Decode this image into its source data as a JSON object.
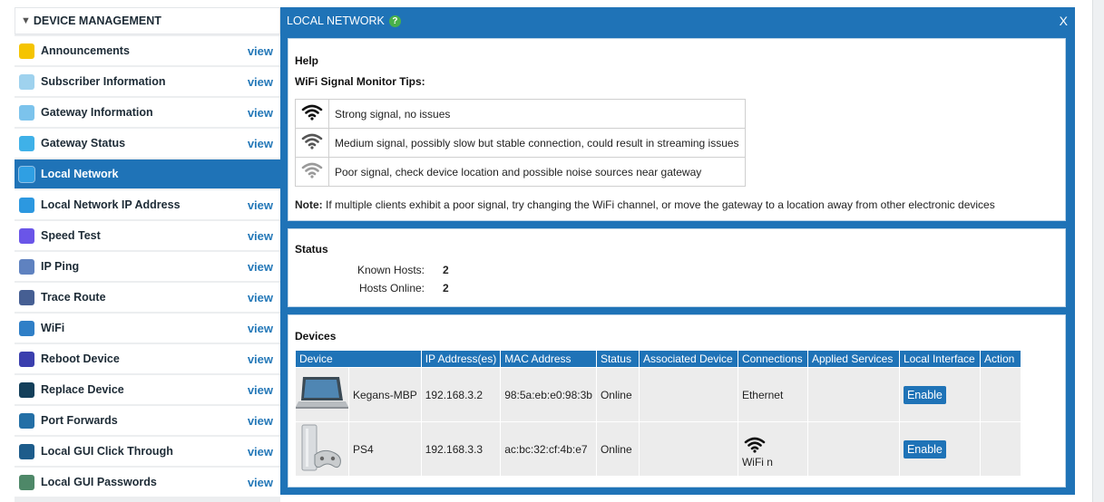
{
  "sidebar": {
    "header": "DEVICE MANAGEMENT",
    "view_label": "view",
    "items": [
      {
        "label": "Announcements",
        "color": "#f5c400"
      },
      {
        "label": "Subscriber Information",
        "color": "#9fd2ee"
      },
      {
        "label": "Gateway Information",
        "color": "#7cc3ec"
      },
      {
        "label": "Gateway Status",
        "color": "#3fb1e8"
      },
      {
        "label": "Local Network",
        "color": "#2f9fe3"
      },
      {
        "label": "Local Network IP Address",
        "color": "#2c98e0"
      },
      {
        "label": "Speed Test",
        "color": "#6a55e8"
      },
      {
        "label": "IP Ping",
        "color": "#5f82c0"
      },
      {
        "label": "Trace Route",
        "color": "#465f93"
      },
      {
        "label": "WiFi",
        "color": "#2f7fc7"
      },
      {
        "label": "Reboot Device",
        "color": "#3b3fae"
      },
      {
        "label": "Replace Device",
        "color": "#133f5a"
      },
      {
        "label": "Port Forwards",
        "color": "#236fa6"
      },
      {
        "label": "Local GUI Click Through",
        "color": "#1d5c8b"
      },
      {
        "label": "Local GUI Passwords",
        "color": "#4e8868"
      }
    ]
  },
  "panel": {
    "title": "LOCAL NETWORK",
    "help_icon": "?",
    "close": "X",
    "help": {
      "title": "Help",
      "subtitle": "WiFi Signal Monitor Tips:",
      "tips": [
        {
          "text": "Strong signal, no issues",
          "icon_color": "#111111"
        },
        {
          "text": "Medium signal, possibly slow but stable connection, could result in streaming issues",
          "icon_color": "#555555"
        },
        {
          "text": "Poor signal, check device location and possible noise sources near gateway",
          "icon_color": "#9a9a9a"
        }
      ],
      "note_label": "Note:",
      "note_text": " If multiple clients exhibit a poor signal, try changing the WiFi channel, or move the gateway to a location away from other electronic devices"
    },
    "status": {
      "title": "Status",
      "known_hosts_label": "Known Hosts:",
      "known_hosts_value": "2",
      "hosts_online_label": "Hosts Online:",
      "hosts_online_value": "2"
    },
    "devices": {
      "title": "Devices",
      "columns": [
        "Device",
        "IP Address(es)",
        "MAC Address",
        "Status",
        "Associated Device",
        "Connections",
        "Applied Services",
        "Local Interface",
        "Action"
      ],
      "rows": [
        {
          "name": "Kegans-MBP",
          "icon": "laptop-icon",
          "ip": "192.168.3.2",
          "mac": "98:5a:eb:e0:98:3b",
          "status": "Online",
          "associated": "",
          "connection": "Ethernet",
          "services": "",
          "interface_button": "Enable",
          "action": ""
        },
        {
          "name": "PS4",
          "icon": "game-console-icon",
          "ip": "192.168.3.3",
          "mac": "ac:bc:32:cf:4b:e7",
          "status": "Online",
          "associated": "",
          "connection": "WiFi n",
          "services": "",
          "interface_button": "Enable",
          "action": ""
        }
      ]
    }
  },
  "colors": {
    "accent": "#1f73b7",
    "link": "#2478b8",
    "help_green": "#48b14a"
  }
}
